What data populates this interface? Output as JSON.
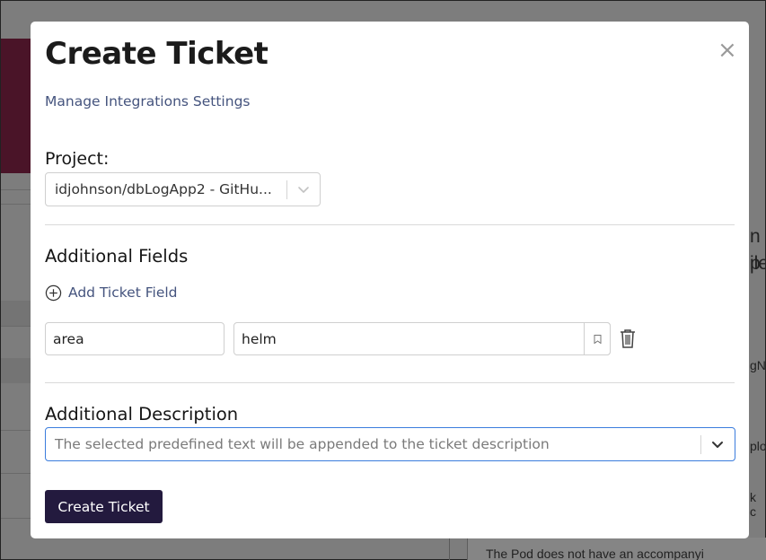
{
  "background": {
    "right_text_1": "n p",
    "right_text_2": "ile",
    "right_text_3": "gN",
    "right_text_4": "plo",
    "right_text_5": "k c",
    "bottom_text": "The Pod does not have an accompanyi"
  },
  "modal": {
    "title": "Create Ticket",
    "close_label": "×",
    "manage_link": "Manage Integrations Settings",
    "project_label": "Project:",
    "project_value": "idjohnson/dbLogApp2 - GitHu...",
    "additional_fields_title": "Additional Fields",
    "add_ticket_field": "Add Ticket Field",
    "field_key": "area",
    "field_value": "helm",
    "additional_description_title": "Additional Description",
    "description_placeholder": "The selected predefined text will be appended to the ticket description",
    "create_button": "Create Ticket"
  },
  "colors": {
    "accent_link": "#45547e",
    "primary_button": "#231a3e",
    "focus_border": "#3b7ddd",
    "overlay": "#7d7d7d"
  },
  "icons": {
    "close": "close-icon",
    "chevron": "chevron-down-icon",
    "add": "plus-circle-icon",
    "bookmark": "bookmark-icon",
    "trash": "trash-icon"
  }
}
